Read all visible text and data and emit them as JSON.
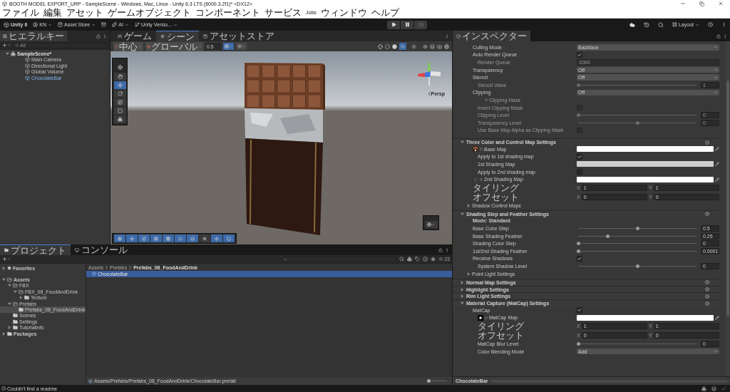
{
  "window": {
    "title": "BOOTH MODEL EXPORT_URP - SampleScene - Windows, Mac, Linux - Unity 6.3 LTS (6000.3.2f1)* <DX12>"
  },
  "menu": [
    "ファイル",
    "編集",
    "アセット",
    "ゲームオブジェクト",
    "コンポーネント",
    "サービス",
    "Jobs",
    "ウィンドウ",
    "ヘルプ"
  ],
  "toolbar": {
    "account": "Unity 6",
    "user": "KN",
    "store": "Asset Store",
    "ai": "AI",
    "version": "Unity Versio...",
    "layout": "Layout"
  },
  "hierarchy": {
    "tab": "ヒエラルキー",
    "search_placeholder": "All",
    "tree": [
      {
        "label": "SampleScene*",
        "kind": "scene",
        "expanded": true,
        "children": [
          {
            "label": "Main Camera",
            "kind": "object"
          },
          {
            "label": "Directional Light",
            "kind": "object"
          },
          {
            "label": "Global Volume",
            "kind": "object"
          },
          {
            "label": "ChocolateBar",
            "kind": "prefab"
          }
        ]
      }
    ]
  },
  "scene": {
    "tabs": [
      {
        "label": "ゲーム",
        "selected": false
      },
      {
        "label": "シーン",
        "selected": true
      },
      {
        "label": "アセットストア",
        "selected": false
      }
    ],
    "pivot": "中心",
    "space": "グローバル",
    "snap": "0.5",
    "projection": "Persp"
  },
  "project": {
    "tabs": [
      {
        "label": "プロジェクト",
        "selected": true
      },
      {
        "label": "コンソール",
        "selected": false
      }
    ],
    "count": "23",
    "tree": [
      {
        "label": "Favorites",
        "kind": "favorites",
        "expanded": false,
        "selected": false
      },
      {
        "label": "Assets",
        "kind": "folder",
        "expanded": true,
        "selected": false,
        "children": [
          {
            "label": "FBX",
            "kind": "folder",
            "expanded": true,
            "selected": false,
            "children": [
              {
                "label": "FBX_08_FoodAndDrink",
                "kind": "folder",
                "expanded": true,
                "selected": false,
                "children": [
                  {
                    "label": "Texture",
                    "kind": "folder",
                    "expanded": false,
                    "selected": false
                  }
                ]
              }
            ]
          },
          {
            "label": "Prefabs",
            "kind": "folder",
            "expanded": true,
            "selected": false,
            "children": [
              {
                "label": "Prefabs_08_FoodAndDrink",
                "kind": "folder",
                "selected": true
              }
            ]
          },
          {
            "label": "Scenes",
            "kind": "folder",
            "selected": false
          },
          {
            "label": "Settings",
            "kind": "folder",
            "selected": false
          },
          {
            "label": "TutorialInfo",
            "kind": "folder",
            "expanded": false,
            "selected": false
          }
        ]
      },
      {
        "label": "Packages",
        "kind": "folder",
        "expanded": false,
        "selected": false
      }
    ],
    "breadcrumb": [
      "Assets",
      "Prefabs",
      "Prefabs_08_FoodAndDrink"
    ],
    "items": [
      {
        "label": "ChocolateBar",
        "selected": true
      }
    ],
    "path": "Assets/Prefabs/Prefabs_08_FoodAndDrink/ChocolateBar.prefab",
    "zoom": {
      "level": 0.05
    }
  },
  "inspector": {
    "tab": "インスペクター",
    "object": "ChocolateBar",
    "rows": [
      {
        "kind": "dropdown",
        "label": "Culling Mode",
        "value": "Backface",
        "disabled": false
      },
      {
        "kind": "check",
        "label": "Auto Render Queue",
        "checked": true,
        "disabled": false,
        "children": [
          {
            "kind": "field",
            "label": "Render Queue",
            "value": "2000",
            "disabled": true
          }
        ]
      },
      {
        "kind": "dropdown",
        "label": "Transparency",
        "value": "Off",
        "disabled": false
      },
      {
        "kind": "dropdown",
        "label": "Stencil",
        "value": "Off",
        "disabled": false,
        "children": [
          {
            "kind": "slider",
            "label": "Stencil Value",
            "level": 0,
            "value": "1",
            "disabled": true
          }
        ]
      },
      {
        "kind": "dropdown",
        "label": "Clipping",
        "value": "Off",
        "disabled": false,
        "children": [
          {
            "kind": "texture",
            "label": "Clipping Mask",
            "disabled": true
          },
          {
            "kind": "check",
            "label": "Invert Clipping Mask",
            "checked": false,
            "disabled": true
          },
          {
            "kind": "slider",
            "label": "Clipping Level",
            "level": 0,
            "value": "0",
            "disabled": true
          },
          {
            "kind": "slider",
            "label": "Transparency Level",
            "level": 0.5,
            "value": "0",
            "disabled": true
          },
          {
            "kind": "check",
            "label": "Use Base Map Alpha as Clipping Mask",
            "checked": false,
            "disabled": true
          }
        ]
      }
    ],
    "sections": [
      {
        "title": "Three Color and Control Map Settings",
        "expanded": true,
        "rows": [
          {
            "kind": "texture",
            "label": "Base Map",
            "thumbnail": {
              "kind": "image"
            },
            "color": "#ffffff",
            "disabled": false,
            "children": [
              {
                "kind": "check",
                "label": "Apply to 1st shading map",
                "checked": true,
                "disabled": false
              },
              {
                "kind": "color",
                "label": "1st Shading Map",
                "color": "#cfcfcf",
                "disabled": false
              },
              {
                "kind": "check",
                "label": "Apply to 2nd shading map",
                "checked": false,
                "disabled": false
              }
            ]
          },
          {
            "kind": "texture",
            "label": "2nd Shading Map",
            "thumbnail": {
              "kind": "empty"
            },
            "color": "#ffffff",
            "disabled": false
          },
          {
            "kind": "vector",
            "label": "タイリング",
            "fields": [
              {
                "axis": "X",
                "value": "1"
              },
              {
                "axis": "Y",
                "value": "1"
              }
            ],
            "disabled": false
          },
          {
            "kind": "vector",
            "label": "オフセット",
            "fields": [
              {
                "axis": "X",
                "value": "0"
              },
              {
                "axis": "Y",
                "value": "0"
              }
            ],
            "disabled": false
          },
          {
            "kind": "foldout",
            "label": "Shadow Control Maps",
            "expanded": false,
            "disabled": false
          }
        ]
      },
      {
        "title": "Shading Step and Feather Settings",
        "expanded": true,
        "rows": [
          {
            "kind": "heading",
            "label": "Mode: Standard",
            "disabled": false
          },
          {
            "kind": "slider",
            "label": "Base Color Step",
            "level": 0.5,
            "value": "0.5",
            "disabled": false
          },
          {
            "kind": "slider",
            "label": "Base Shading Feather",
            "level": 0.25,
            "value": "0.25",
            "disabled": false
          },
          {
            "kind": "slider",
            "label": "Shading Color Step",
            "level": 0,
            "value": "0",
            "disabled": false
          },
          {
            "kind": "slider",
            "label": "1st/2nd Shading Feather",
            "level": 0,
            "value": "0.0001",
            "disabled": false
          },
          {
            "kind": "check",
            "label": "Receive Shadows",
            "checked": true,
            "disabled": false,
            "children": [
              {
                "kind": "slider",
                "label": "System Shadow Level",
                "level": 0.5,
                "value": "0",
                "disabled": false
              }
            ]
          },
          {
            "kind": "foldout",
            "label": "Point Light Settings",
            "expanded": false,
            "disabled": false
          }
        ]
      },
      {
        "title": "Normal Map Settings",
        "expanded": false
      },
      {
        "title": "Highlight Settings",
        "expanded": false
      },
      {
        "title": "Rim Light Settings",
        "expanded": false
      },
      {
        "title": "Material Capture (MatCap) Settings",
        "expanded": true,
        "rows": [
          {
            "kind": "check",
            "label": "MatCap",
            "checked": true,
            "disabled": false,
            "children": [
              {
                "kind": "texture",
                "label": "MatCap Map",
                "thumbnail": {
                  "kind": "matcap"
                },
                "color": "#ffffff",
                "disabled": false
              },
              {
                "kind": "vector",
                "label": "タイリング",
                "fields": [
                  {
                    "axis": "X",
                    "value": "1"
                  },
                  {
                    "axis": "Y",
                    "value": "1"
                  }
                ],
                "disabled": false
              },
              {
                "kind": "vector",
                "label": "オフセット",
                "fields": [
                  {
                    "axis": "X",
                    "value": "0"
                  },
                  {
                    "axis": "Y",
                    "value": "0"
                  }
                ],
                "disabled": false
              },
              {
                "kind": "slider",
                "label": "MatCap Blur Level",
                "level": 0,
                "value": "0",
                "disabled": false
              },
              {
                "kind": "dropdown",
                "label": "Color Blending Mode",
                "value": "Add",
                "disabled": false
              }
            ]
          }
        ]
      }
    ]
  },
  "status_bar": {
    "message": "Couldn't find a readme"
  }
}
